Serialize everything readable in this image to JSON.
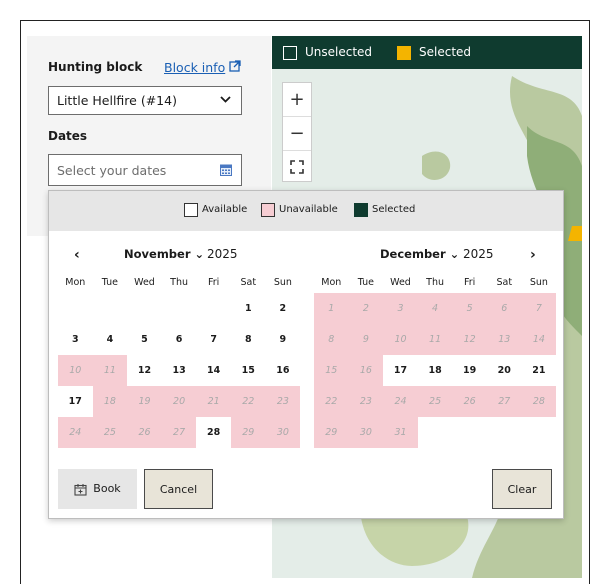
{
  "form": {
    "hunting_block_label": "Hunting block",
    "block_info_link": "Block info",
    "selected_block": "Little Hellfire (#14)",
    "dates_label": "Dates",
    "dates_placeholder": "Select your dates"
  },
  "map": {
    "legend": {
      "unselected": "Unselected",
      "selected": "Selected"
    },
    "controls": {
      "zoom_in": "+",
      "zoom_out": "−",
      "fullscreen": "⛶"
    },
    "colors": {
      "legend_bg": "#0f3b2f",
      "selected": "#f4b400"
    }
  },
  "datepicker": {
    "legend": {
      "available": "Available",
      "unavailable": "Unavailable",
      "selected": "Selected"
    },
    "weekdays": [
      "Mon",
      "Tue",
      "Wed",
      "Thu",
      "Fri",
      "Sat",
      "Sun"
    ],
    "left": {
      "month": "November",
      "year": "2025"
    },
    "right": {
      "month": "December",
      "year": "2025"
    },
    "prev_icon": "‹",
    "next_icon": "›",
    "buttons": {
      "book": "Book",
      "cancel": "Cancel",
      "clear": "Clear"
    },
    "november_cells": [
      "",
      "",
      "",
      "",
      "",
      "1",
      "2",
      "3",
      "4",
      "5",
      "6",
      "7",
      "8",
      "9",
      "10",
      "11",
      "12",
      "13",
      "14",
      "15",
      "16",
      "17",
      "18",
      "19",
      "20",
      "21",
      "22",
      "23",
      "24",
      "25",
      "26",
      "27",
      "28",
      "29",
      "30"
    ],
    "november_unavailable": [
      "10",
      "11",
      "18",
      "19",
      "20",
      "21",
      "22",
      "23",
      "24",
      "25",
      "26",
      "27",
      "29",
      "30"
    ],
    "december_cells": [
      "1",
      "2",
      "3",
      "4",
      "5",
      "6",
      "7",
      "8",
      "9",
      "10",
      "11",
      "12",
      "13",
      "14",
      "15",
      "16",
      "17",
      "18",
      "19",
      "20",
      "21",
      "22",
      "23",
      "24",
      "25",
      "26",
      "27",
      "28",
      "29",
      "30",
      "31",
      "",
      "",
      "",
      ""
    ],
    "december_unavailable": [
      "1",
      "2",
      "3",
      "4",
      "5",
      "6",
      "7",
      "8",
      "9",
      "10",
      "11",
      "12",
      "13",
      "14",
      "15",
      "16",
      "22",
      "23",
      "24",
      "25",
      "26",
      "27",
      "28",
      "29",
      "30",
      "31"
    ],
    "colors": {
      "unavailable": "#f6cdd3",
      "selected": "#0f3b2f"
    }
  }
}
